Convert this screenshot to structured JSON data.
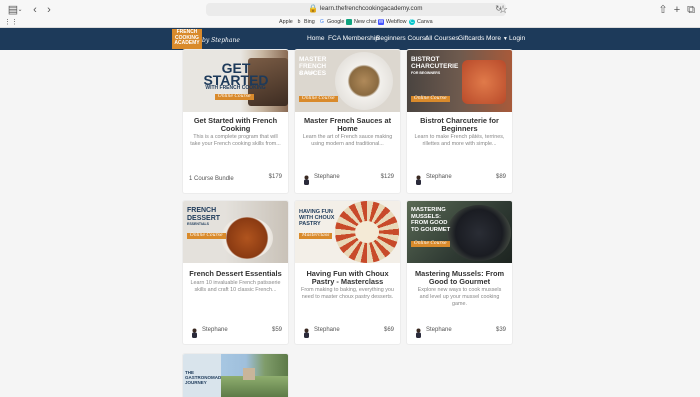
{
  "browser": {
    "url": "learn.thefrenchcookingacademy.com",
    "bookmarks": [
      {
        "label": "Apple",
        "icon": "apple-icon"
      },
      {
        "label": "Bing",
        "icon": "bing-icon"
      },
      {
        "label": "Google",
        "icon": "google-icon"
      },
      {
        "label": "New chat",
        "icon": "chat-icon"
      },
      {
        "label": "Webflow",
        "icon": "webflow-icon"
      },
      {
        "label": "Canva",
        "icon": "canva-icon"
      }
    ]
  },
  "site": {
    "logo_text": "FRENCH COOKING ACADEMY",
    "logo_script": "by Stephane",
    "nav": [
      "Home",
      "FCA Membership",
      "Beginners Course",
      "All Courses",
      "Giftcards",
      "More",
      "Login"
    ]
  },
  "cards": [
    {
      "img_title": "Get Started",
      "img_sub": "with French Cooking",
      "img_banner": "Online Course",
      "title": "Get Started with French Cooking",
      "desc": "This is a complete program that will take your French cooking skills from...",
      "author": "1 Course Bundle",
      "price": "$179"
    },
    {
      "img_title": "Master French Sauces",
      "img_sub": "at home",
      "img_banner": "Online Course",
      "title": "Master French Sauces at Home",
      "desc": "Learn the art of French sauce making using modern and traditional...",
      "author": "Stephane",
      "price": "$129"
    },
    {
      "img_title": "Bistrot Charcuterie",
      "img_sub": "for beginners",
      "img_banner": "Online Course",
      "title": "Bistrot Charcuterie for Beginners",
      "desc": "Learn to make French pâtés, terrines, rillettes and more with simple...",
      "author": "Stephane",
      "price": "$89"
    },
    {
      "img_title": "French Dessert",
      "img_sub": "essentials",
      "img_banner": "Online Course",
      "title": "French Dessert Essentials",
      "desc": "Learn 10 invaluable French patisserie skills and craft 10 classic French...",
      "author": "Stephane",
      "price": "$59"
    },
    {
      "img_title": "Having Fun with Choux Pastry",
      "img_sub": "",
      "img_banner": "Masterclass",
      "title": "Having Fun with Choux Pastry - Masterclass",
      "desc": "From making to baking, everything you need to master choux pastry desserts.",
      "author": "Stephane",
      "price": "$69"
    },
    {
      "img_title": "Mastering Mussels: From Good to Gourmet",
      "img_sub": "",
      "img_banner": "Online Course",
      "title": "Mastering Mussels: From Good to Gourmet",
      "desc": "Explore new ways to cook mussels and level up your mussel cooking game.",
      "author": "Stephane",
      "price": "$39"
    },
    {
      "img_title": "The Gastronomad Journey",
      "img_sub": "",
      "img_banner": "",
      "title": "",
      "desc": "",
      "author": "",
      "price": ""
    }
  ]
}
